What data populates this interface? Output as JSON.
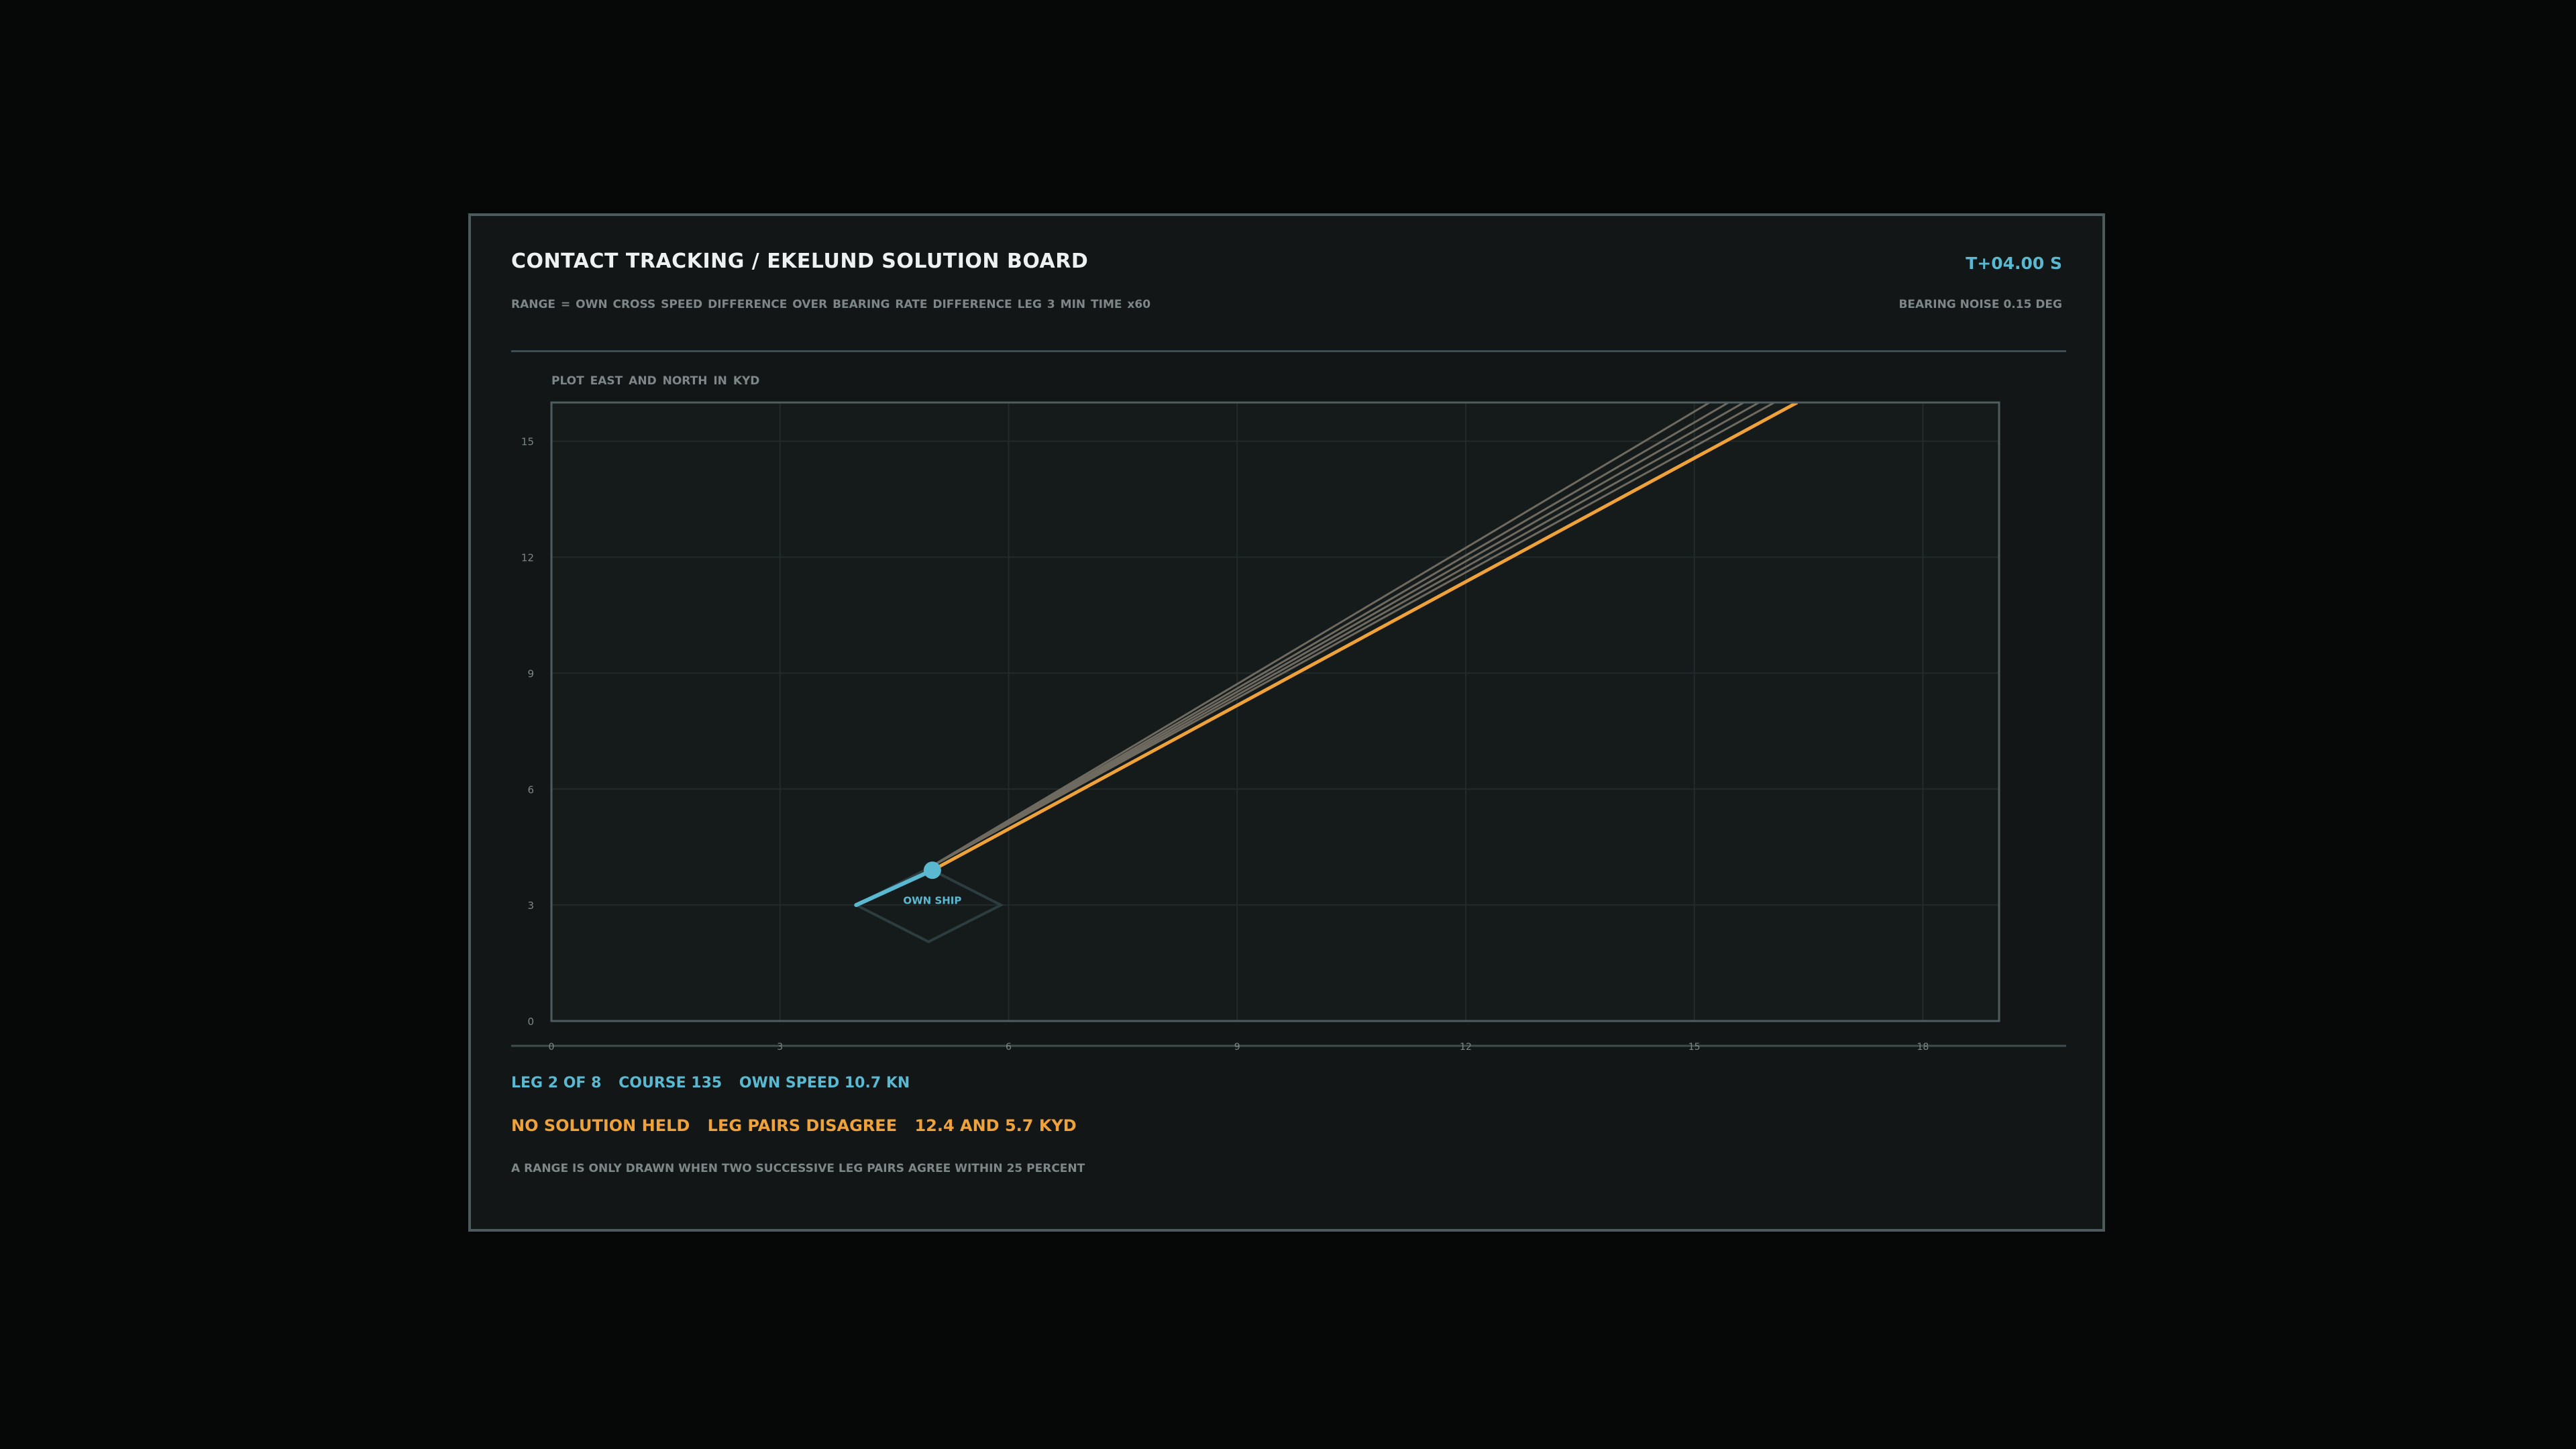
{
  "header": {
    "title": "CONTACT TRACKING / EKELUND SOLUTION BOARD",
    "subtitle": "RANGE = OWN CROSS SPEED DIFFERENCE OVER BEARING RATE DIFFERENCE   LEG 3 MIN   TIME x60",
    "clock": "T+04.00 S",
    "noise": "BEARING NOISE 0.15 DEG"
  },
  "plot": {
    "caption": "PLOT   EAST AND NORTH IN KYD"
  },
  "colors": {
    "own_ship": "#5ab8d0",
    "solution": "#f0a23a",
    "bearing_history": "#6e6a60",
    "grid": "#222b2c"
  },
  "chart_data": {
    "type": "line",
    "xlim": [
      0,
      19
    ],
    "ylim": [
      0,
      16
    ],
    "x_ticks": [
      0,
      3,
      6,
      9,
      12,
      15,
      18
    ],
    "x_tick_labels": [
      "0",
      "3",
      "6",
      "9",
      "12",
      "15",
      "18"
    ],
    "y_ticks": [
      0,
      3,
      6,
      9,
      12,
      15
    ],
    "y_tick_labels": [
      "0",
      "3",
      "6",
      "9",
      "12",
      "15"
    ],
    "grid": true,
    "own_ship": {
      "label": "OWN SHIP",
      "track": [
        [
          4.0,
          3.0
        ],
        [
          5.0,
          3.9
        ]
      ],
      "position": [
        5.0,
        3.9
      ],
      "leg_box": [
        [
          4.0,
          3.0
        ],
        [
          4.95,
          3.95
        ],
        [
          5.9,
          3.0
        ],
        [
          4.95,
          2.05
        ]
      ]
    },
    "bearing_lines": [
      {
        "from": [
          4.9,
          3.9
        ],
        "to": [
          15.2,
          16.0
        ]
      },
      {
        "from": [
          4.9,
          3.9
        ],
        "to": [
          15.45,
          16.0
        ]
      },
      {
        "from": [
          4.9,
          3.9
        ],
        "to": [
          15.65,
          16.0
        ]
      },
      {
        "from": [
          4.9,
          3.9
        ],
        "to": [
          15.85,
          16.0
        ]
      },
      {
        "from": [
          4.9,
          3.9
        ],
        "to": [
          16.05,
          16.0
        ]
      }
    ],
    "current_bearing": {
      "from": [
        5.0,
        3.9
      ],
      "to": [
        16.35,
        16.0
      ]
    }
  },
  "footer": {
    "leg": "LEG 2 OF 8",
    "course": "COURSE 135",
    "own_speed": "OWN SPEED 10.7 KN",
    "solution_status": "NO SOLUTION HELD",
    "disagreement": "LEG PAIRS DISAGREE",
    "ranges": "12.4 AND 5.7 KYD",
    "note": "A RANGE IS ONLY DRAWN WHEN TWO SUCCESSIVE LEG PAIRS AGREE WITHIN 25 PERCENT"
  }
}
